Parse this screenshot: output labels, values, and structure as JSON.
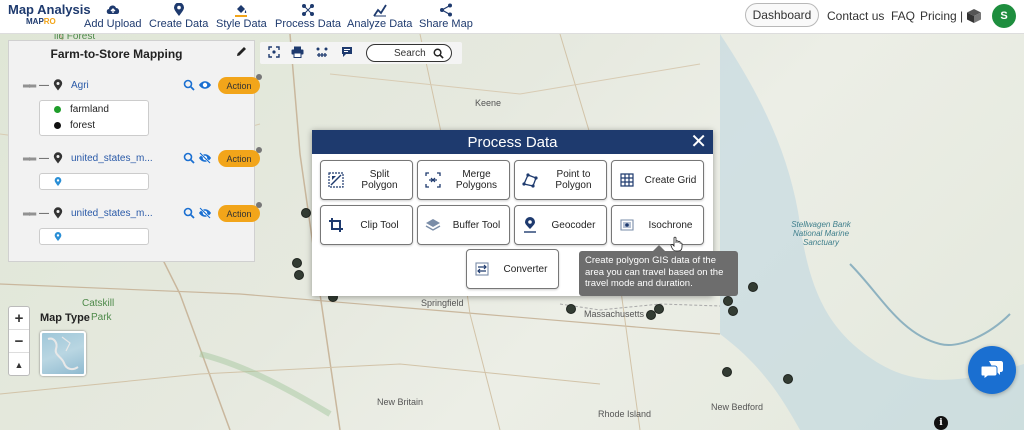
{
  "app": {
    "logo_title": "Map Analysis",
    "logo_sub_a": "MAP",
    "logo_sub_b": "RO"
  },
  "nav": [
    {
      "label": "Add Upload",
      "icon": "cloud-upload-icon"
    },
    {
      "label": "Create Data",
      "icon": "map-pin-icon"
    },
    {
      "label": "Style Data",
      "icon": "paint-bucket-icon"
    },
    {
      "label": "Process Data",
      "icon": "process-nodes-icon"
    },
    {
      "label": "Analyze Data",
      "icon": "analyze-chart-icon"
    },
    {
      "label": "Share Map",
      "icon": "share-icon"
    }
  ],
  "header_right": {
    "dashboard": "Dashboard",
    "contact": "Contact us",
    "faq": "FAQ",
    "pricing": "Pricing |",
    "avatar_initial": "S"
  },
  "layer_panel": {
    "title": "Farm-to-Store Mapping",
    "layers": [
      {
        "name": "Agri",
        "action": "Action",
        "visible": true
      },
      {
        "name": "united_states_m...",
        "action": "Action",
        "visible": false
      },
      {
        "name": "united_states_m...",
        "action": "Action",
        "visible": false
      }
    ],
    "legend": [
      {
        "label": "farmland",
        "color": "#1f9d2a"
      },
      {
        "label": "forest",
        "color": "#111111"
      }
    ]
  },
  "map_toolbar": {
    "search_label": "Search"
  },
  "map_controls": {
    "zoom_in": "+",
    "zoom_out": "−",
    "reset": "▲",
    "map_type_label": "Map Type"
  },
  "modal": {
    "title": "Process Data",
    "close": "✕",
    "tools": [
      {
        "label": "Split Polygon",
        "icon": "split-polygon-icon"
      },
      {
        "label": "Merge Polygons",
        "icon": "merge-polygons-icon"
      },
      {
        "label": "Point to Polygon",
        "icon": "point-to-polygon-icon"
      },
      {
        "label": "Create Grid",
        "icon": "grid-icon"
      },
      {
        "label": "Clip Tool",
        "icon": "crop-icon"
      },
      {
        "label": "Buffer Tool",
        "icon": "layers-icon"
      },
      {
        "label": "Geocoder",
        "icon": "geocoder-pin-icon"
      },
      {
        "label": "Isochrone",
        "icon": "isochrone-icon"
      },
      {
        "label": "Converter",
        "icon": "converter-icon"
      }
    ],
    "tooltip": "Create polygon GIS data of the area you can travel based on the travel mode and duration."
  },
  "map_labels": {
    "wildforest": "ild Forest",
    "keene": "Keene",
    "catskill": "Catskill",
    "park": "Park",
    "springfield": "Springfield",
    "massachusetts": "Massachusetts",
    "new_britain": "New Britain",
    "rhode_island": "Rhode Island",
    "new_bedford": "New Bedford",
    "stellwagen": "Stellwagen Bank National Marine Sanctuary"
  },
  "colors": {
    "brand_navy": "#1e3a6e",
    "accent_orange": "#f2a51a",
    "chat_blue": "#1a6fd1",
    "avatar_green": "#1e8e3e"
  }
}
